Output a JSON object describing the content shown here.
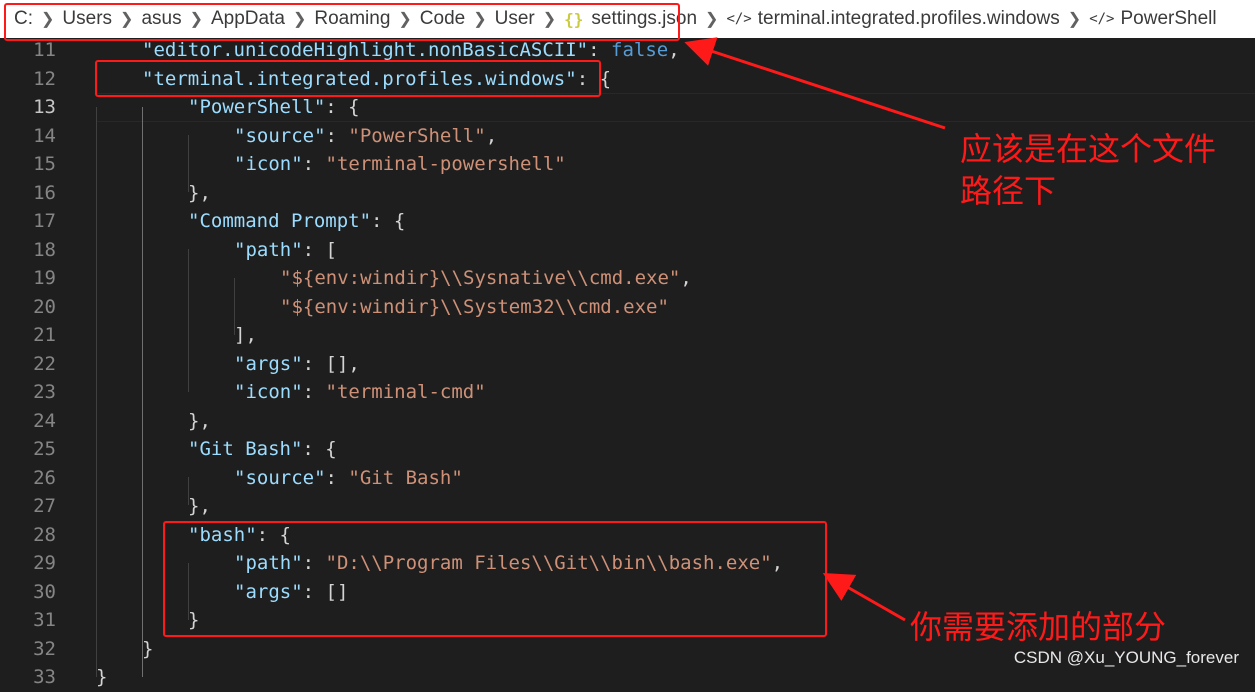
{
  "breadcrumb": {
    "items": [
      "C:",
      "Users",
      "asus",
      "AppData",
      "Roaming",
      "Code",
      "User",
      "settings.json",
      "terminal.integrated.profiles.windows",
      "PowerShell"
    ],
    "file_icon": "{}",
    "symbol_icon": "</>"
  },
  "editor": {
    "lines": [
      {
        "num": "11",
        "t": [
          [
            "k",
            "\"editor.unicodeHighlight.nonBasicASCII\""
          ],
          [
            "p",
            ": "
          ],
          [
            "b",
            "false"
          ],
          [
            "p",
            ","
          ]
        ]
      },
      {
        "num": "12",
        "t": [
          [
            "k",
            "\"terminal.integrated.profiles.windows\""
          ],
          [
            "p",
            ": {"
          ]
        ]
      },
      {
        "num": "13",
        "t": [
          [
            "k",
            "\"PowerShell\""
          ],
          [
            "p",
            ": {"
          ]
        ]
      },
      {
        "num": "14",
        "t": [
          [
            "k",
            "\"source\""
          ],
          [
            "p",
            ": "
          ],
          [
            "s",
            "\"PowerShell\""
          ],
          [
            "p",
            ","
          ]
        ]
      },
      {
        "num": "15",
        "t": [
          [
            "k",
            "\"icon\""
          ],
          [
            "p",
            ": "
          ],
          [
            "s",
            "\"terminal-powershell\""
          ]
        ]
      },
      {
        "num": "16",
        "t": [
          [
            "p",
            "},"
          ]
        ]
      },
      {
        "num": "17",
        "t": [
          [
            "k",
            "\"Command Prompt\""
          ],
          [
            "p",
            ": {"
          ]
        ]
      },
      {
        "num": "18",
        "t": [
          [
            "k",
            "\"path\""
          ],
          [
            "p",
            ": ["
          ]
        ]
      },
      {
        "num": "19",
        "t": [
          [
            "s",
            "\"${env:windir}\\\\Sysnative\\\\cmd.exe\""
          ],
          [
            "p",
            ","
          ]
        ]
      },
      {
        "num": "20",
        "t": [
          [
            "s",
            "\"${env:windir}\\\\System32\\\\cmd.exe\""
          ]
        ]
      },
      {
        "num": "21",
        "t": [
          [
            "p",
            "],"
          ]
        ]
      },
      {
        "num": "22",
        "t": [
          [
            "k",
            "\"args\""
          ],
          [
            "p",
            ": [],"
          ]
        ]
      },
      {
        "num": "23",
        "t": [
          [
            "k",
            "\"icon\""
          ],
          [
            "p",
            ": "
          ],
          [
            "s",
            "\"terminal-cmd\""
          ]
        ]
      },
      {
        "num": "24",
        "t": [
          [
            "p",
            "},"
          ]
        ]
      },
      {
        "num": "25",
        "t": [
          [
            "k",
            "\"Git Bash\""
          ],
          [
            "p",
            ": {"
          ]
        ]
      },
      {
        "num": "26",
        "t": [
          [
            "k",
            "\"source\""
          ],
          [
            "p",
            ": "
          ],
          [
            "s",
            "\"Git Bash\""
          ]
        ]
      },
      {
        "num": "27",
        "t": [
          [
            "p",
            "},"
          ]
        ]
      },
      {
        "num": "28",
        "t": [
          [
            "k",
            "\"bash\""
          ],
          [
            "p",
            ": {"
          ]
        ]
      },
      {
        "num": "29",
        "t": [
          [
            "k",
            "\"path\""
          ],
          [
            "p",
            ": "
          ],
          [
            "s",
            "\"D:\\\\Program Files\\\\Git\\\\bin\\\\bash.exe\""
          ],
          [
            "p",
            ","
          ]
        ]
      },
      {
        "num": "30",
        "t": [
          [
            "k",
            "\"args\""
          ],
          [
            "p",
            ": []"
          ]
        ]
      },
      {
        "num": "31",
        "t": [
          [
            "p",
            "}"
          ]
        ]
      },
      {
        "num": "32",
        "t": [
          [
            "p",
            "}"
          ]
        ]
      },
      {
        "num": "33",
        "t": [
          [
            "p",
            "}"
          ]
        ]
      }
    ],
    "active_line": "13"
  },
  "annotations": {
    "path_note": "应该是在这个文件路径下",
    "add_note": "你需要添加的部分"
  },
  "watermark": "CSDN @Xu_YOUNG_forever",
  "colors": {
    "annotation_red": "#ff1a1a",
    "editor_bg": "#1e1e1e",
    "key": "#9cdcfe",
    "string": "#ce9178",
    "keyword": "#569cd6"
  }
}
